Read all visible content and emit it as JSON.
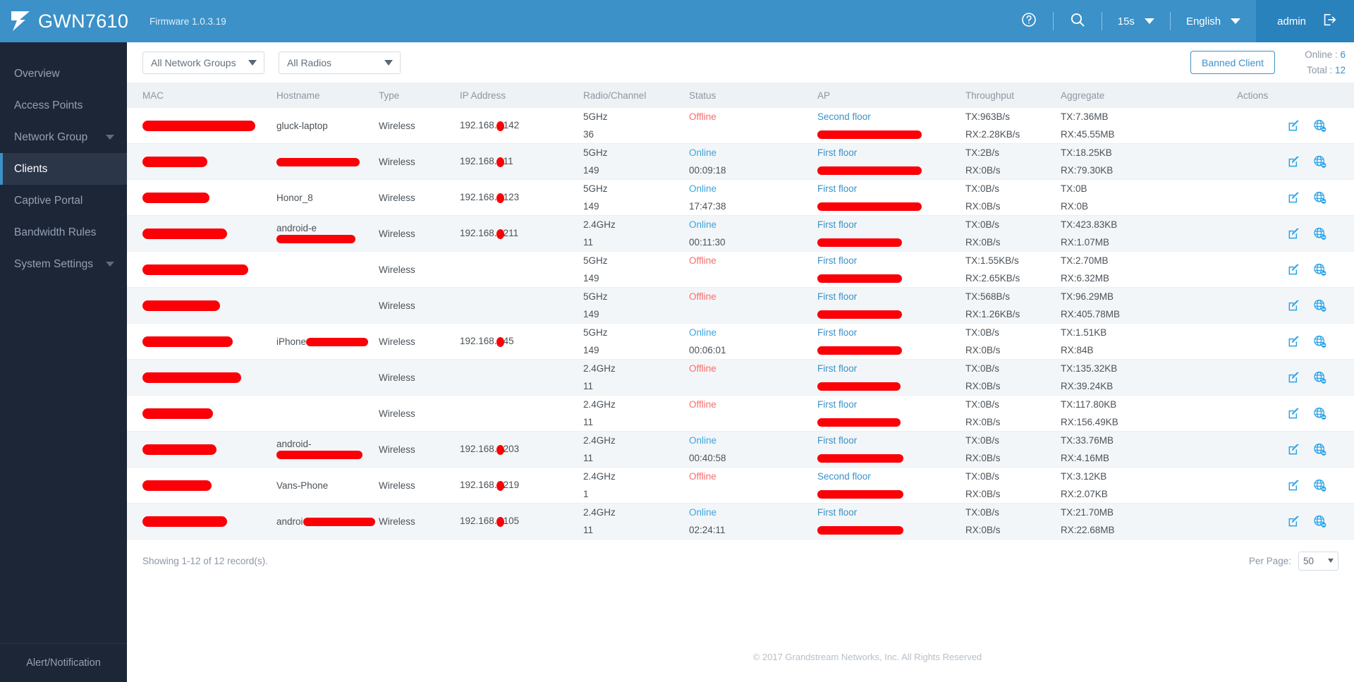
{
  "header": {
    "brand": "GWN7610",
    "firmware": "Firmware 1.0.3.19",
    "help_icon": "help-circle-icon",
    "search_icon": "search-icon",
    "refresh_interval": "15s",
    "language": "English",
    "user": "admin",
    "logout_icon": "logout-icon",
    "accent": "#3b91c8"
  },
  "sidebar": {
    "items": [
      {
        "label": "Overview",
        "active": false,
        "expandable": false
      },
      {
        "label": "Access Points",
        "active": false,
        "expandable": false
      },
      {
        "label": "Network Group",
        "active": false,
        "expandable": true
      },
      {
        "label": "Clients",
        "active": true,
        "expandable": false
      },
      {
        "label": "Captive Portal",
        "active": false,
        "expandable": false
      },
      {
        "label": "Bandwidth Rules",
        "active": false,
        "expandable": false
      },
      {
        "label": "System Settings",
        "active": false,
        "expandable": true
      }
    ],
    "alert": "Alert/Notification"
  },
  "toolbar": {
    "network_group_filter": "All Network Groups",
    "radio_filter": "All Radios",
    "banned_client_label": "Banned Client",
    "online_label": "Online :",
    "online_value": "6",
    "total_label": "Total :",
    "total_value": "12"
  },
  "table": {
    "columns": [
      "MAC",
      "Hostname",
      "Type",
      "IP Address",
      "Radio/Channel",
      "Status",
      "AP",
      "Throughput",
      "Aggregate",
      "Actions"
    ],
    "rows": [
      {
        "mac": "",
        "mac_redacted": true,
        "hostname": "gluck-laptop",
        "hostname_redacted": false,
        "type": "Wireless",
        "ip_prefix": "192.168.",
        "ip_suffix": "142",
        "radio": "5GHz",
        "channel": "36",
        "status": "Offline",
        "status_state": "offline",
        "uptime": "",
        "ap": "Second floor",
        "ap_mac_redacted": true,
        "tx": "TX:963B/s",
        "rx": "RX:2.28KB/s",
        "agg_tx": "TX:7.36MB",
        "agg_rx": "RX:45.55MB"
      },
      {
        "mac": "",
        "mac_redacted": true,
        "hostname": "",
        "hostname_redacted": true,
        "type": "Wireless",
        "ip_prefix": "192.168.",
        "ip_suffix": "11",
        "radio": "5GHz",
        "channel": "149",
        "status": "Online",
        "status_state": "online",
        "uptime": "00:09:18",
        "ap": "First floor",
        "ap_mac_redacted": true,
        "tx": "TX:2B/s",
        "rx": "RX:0B/s",
        "agg_tx": "TX:18.25KB",
        "agg_rx": "RX:79.30KB"
      },
      {
        "mac": "",
        "mac_redacted": true,
        "hostname": "Honor_8",
        "hostname_redacted": false,
        "type": "Wireless",
        "ip_prefix": "192.168.",
        "ip_suffix": "123",
        "radio": "5GHz",
        "channel": "149",
        "status": "Online",
        "status_state": "online",
        "uptime": "17:47:38",
        "ap": "First floor",
        "ap_mac_redacted": true,
        "tx": "TX:0B/s",
        "rx": "RX:0B/s",
        "agg_tx": "TX:0B",
        "agg_rx": "RX:0B"
      },
      {
        "mac": "",
        "mac_redacted": true,
        "hostname": "android-e",
        "hostname_redacted": true,
        "type": "Wireless",
        "ip_prefix": "192.168.",
        "ip_suffix": "211",
        "radio": "2.4GHz",
        "channel": "11",
        "status": "Online",
        "status_state": "online",
        "uptime": "00:11:30",
        "ap": "First floor",
        "ap_mac_redacted": true,
        "tx": "TX:0B/s",
        "rx": "RX:0B/s",
        "agg_tx": "TX:423.83KB",
        "agg_rx": "RX:1.07MB"
      },
      {
        "mac": "",
        "mac_redacted": true,
        "hostname": "",
        "hostname_redacted": false,
        "type": "Wireless",
        "ip_prefix": "",
        "ip_suffix": "",
        "radio": "5GHz",
        "channel": "149",
        "status": "Offline",
        "status_state": "offline",
        "uptime": "",
        "ap": "First floor",
        "ap_mac_redacted": true,
        "tx": "TX:1.55KB/s",
        "rx": "RX:2.65KB/s",
        "agg_tx": "TX:2.70MB",
        "agg_rx": "RX:6.32MB"
      },
      {
        "mac": "",
        "mac_redacted": true,
        "hostname": "",
        "hostname_redacted": false,
        "type": "Wireless",
        "ip_prefix": "",
        "ip_suffix": "",
        "radio": "5GHz",
        "channel": "149",
        "status": "Offline",
        "status_state": "offline",
        "uptime": "",
        "ap": "First floor",
        "ap_mac_redacted": true,
        "tx": "TX:568B/s",
        "rx": "RX:1.26KB/s",
        "agg_tx": "TX:96.29MB",
        "agg_rx": "RX:405.78MB"
      },
      {
        "mac": "",
        "mac_redacted": true,
        "hostname": "iPhone",
        "hostname_redacted": true,
        "type": "Wireless",
        "ip_prefix": "192.168.",
        "ip_suffix": "45",
        "radio": "5GHz",
        "channel": "149",
        "status": "Online",
        "status_state": "online",
        "uptime": "00:06:01",
        "ap": "First floor",
        "ap_mac_redacted": true,
        "tx": "TX:0B/s",
        "rx": "RX:0B/s",
        "agg_tx": "TX:1.51KB",
        "agg_rx": "RX:84B"
      },
      {
        "mac": "",
        "mac_redacted": true,
        "hostname": "",
        "hostname_redacted": false,
        "type": "Wireless",
        "ip_prefix": "",
        "ip_suffix": "",
        "radio": "2.4GHz",
        "channel": "11",
        "status": "Offline",
        "status_state": "offline",
        "uptime": "",
        "ap": "First floor",
        "ap_mac_redacted": true,
        "tx": "TX:0B/s",
        "rx": "RX:0B/s",
        "agg_tx": "TX:135.32KB",
        "agg_rx": "RX:39.24KB"
      },
      {
        "mac": "",
        "mac_redacted": true,
        "hostname": "",
        "hostname_redacted": false,
        "type": "Wireless",
        "ip_prefix": "",
        "ip_suffix": "",
        "radio": "2.4GHz",
        "channel": "11",
        "status": "Offline",
        "status_state": "offline",
        "uptime": "",
        "ap": "First floor",
        "ap_mac_redacted": true,
        "tx": "TX:0B/s",
        "rx": "RX:0B/s",
        "agg_tx": "TX:117.80KB",
        "agg_rx": "RX:156.49KB"
      },
      {
        "mac": "",
        "mac_redacted": true,
        "hostname": "android-",
        "hostname_redacted": true,
        "type": "Wireless",
        "ip_prefix": "192.168.",
        "ip_suffix": "203",
        "radio": "2.4GHz",
        "channel": "11",
        "status": "Online",
        "status_state": "online",
        "uptime": "00:40:58",
        "ap": "First floor",
        "ap_mac_redacted": true,
        "tx": "TX:0B/s",
        "rx": "RX:0B/s",
        "agg_tx": "TX:33.76MB",
        "agg_rx": "RX:4.16MB"
      },
      {
        "mac": "",
        "mac_redacted": true,
        "hostname": "Vans-Phone",
        "hostname_redacted": false,
        "type": "Wireless",
        "ip_prefix": "192.168.",
        "ip_suffix": "219",
        "radio": "2.4GHz",
        "channel": "1",
        "status": "Offline",
        "status_state": "offline",
        "uptime": "",
        "ap": "Second floor",
        "ap_mac_redacted": true,
        "tx": "TX:0B/s",
        "rx": "RX:0B/s",
        "agg_tx": "TX:3.12KB",
        "agg_rx": "RX:2.07KB"
      },
      {
        "mac": "",
        "mac_redacted": true,
        "hostname": "androi",
        "hostname_redacted": true,
        "type": "Wireless",
        "ip_prefix": "192.168.",
        "ip_suffix": "105",
        "radio": "2.4GHz",
        "channel": "11",
        "status": "Online",
        "status_state": "online",
        "uptime": "02:24:11",
        "ap": "First floor",
        "ap_mac_redacted": true,
        "tx": "TX:0B/s",
        "rx": "RX:0B/s",
        "agg_tx": "TX:21.70MB",
        "agg_rx": "RX:22.68MB"
      }
    ],
    "action_icons": [
      "edit-icon",
      "block-internet-icon"
    ]
  },
  "footer": {
    "showing": "Showing 1-12 of 12 record(s).",
    "per_page_label": "Per Page:",
    "per_page_value": "50",
    "copyright": "© 2017 Grandstream Networks, Inc. All Rights Reserved"
  }
}
